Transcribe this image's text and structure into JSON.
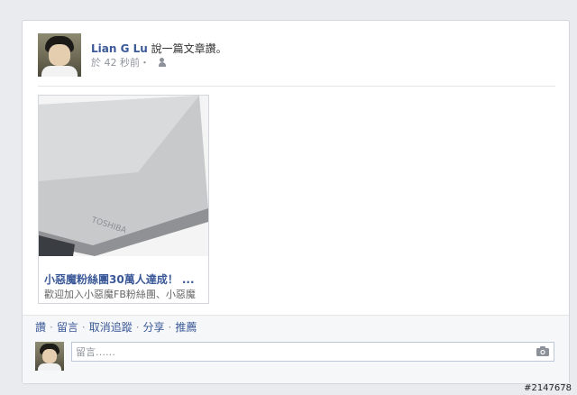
{
  "post": {
    "author_name": "Lian G Lu",
    "action_text": "說一篇文章讚。",
    "timestamp": "於 42 秒前・",
    "audience_icon": "friends-icon"
  },
  "shared_link": {
    "image_icon": "laptop-image",
    "title": "小惡魔粉絲團30萬人達成！ ...",
    "description": "歡迎加入小惡魔FB粉絲團、小惡魔"
  },
  "actions": {
    "like": "讚",
    "comment": "留言",
    "unfollow": "取消追蹤",
    "share": "分享",
    "promote": "推薦"
  },
  "comment_box": {
    "placeholder": "留言……",
    "camera_icon": "camera-icon"
  },
  "watermark": "#2147678"
}
